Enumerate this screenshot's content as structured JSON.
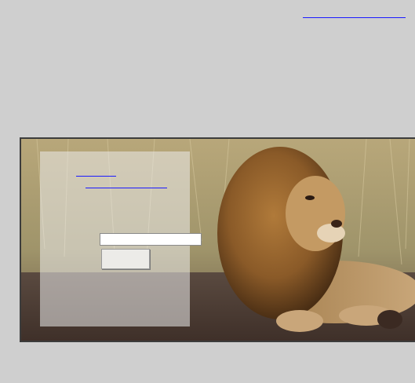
{
  "top_link": {
    "label": ""
  },
  "panel": {
    "link_1_label": "",
    "link_2_label": "",
    "input_value": "",
    "input_placeholder": "",
    "button_label": ""
  },
  "colors": {
    "page_background": "#cfcfcf",
    "link": "#1a1aff",
    "frame_border": "#3c3c3c"
  }
}
